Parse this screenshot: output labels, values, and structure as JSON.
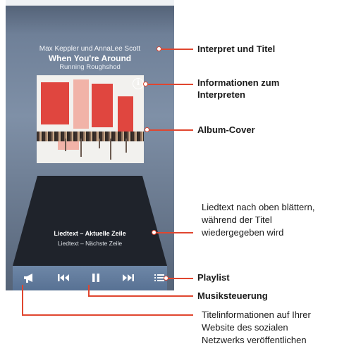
{
  "track": {
    "artist": "Max Keppler und AnnaLee Scott",
    "title": "When You're Around",
    "album": "Running Roughshod"
  },
  "lyrics": {
    "current": "Liedtext – Aktuelle Zeile",
    "next": "Liedtext – Nächste Zeile"
  },
  "controls": [
    {
      "name": "share-icon"
    },
    {
      "name": "previous-icon"
    },
    {
      "name": "pause-icon"
    },
    {
      "name": "next-icon"
    },
    {
      "name": "playlist-icon"
    }
  ],
  "annotations": {
    "artist_title": "Interpret und Titel",
    "artist_info_line1": "Informationen zum",
    "artist_info_line2": "Interpreten",
    "album_cover": "Album-Cover",
    "lyrics_scroll_line1": "Liedtext nach oben blättern,",
    "lyrics_scroll_line2": "während der Titel",
    "lyrics_scroll_line3": "wiedergegeben wird",
    "playlist": "Playlist",
    "music_controls": "Musiksteuerung",
    "share_line1": "Titelinformationen auf Ihrer",
    "share_line2": "Website des sozialen",
    "share_line3": "Netzwerks veröffentlichen"
  },
  "colors": {
    "accent": "#e0462f",
    "screen": "#7f90a7",
    "control_bar": "#5a7394"
  }
}
